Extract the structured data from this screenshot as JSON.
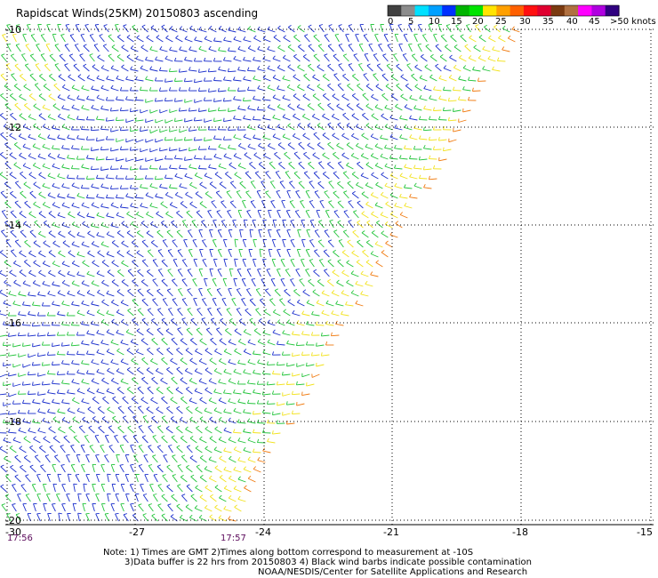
{
  "title": "Rapidscat Winds(25KM) 20150803 ascending",
  "legend": {
    "labels": [
      "0",
      "5",
      "10",
      "15",
      "20",
      "25",
      "30",
      "35",
      "40",
      "45",
      ">50 knots"
    ],
    "colors": [
      "#404040",
      "#8c8c8c",
      "#00e0ff",
      "#00a0ff",
      "#0030ff",
      "#00b400",
      "#00e400",
      "#ffe400",
      "#ffa000",
      "#ff6000",
      "#ff1010",
      "#e00030",
      "#7a3a10",
      "#b07040",
      "#ff00ff",
      "#b000e0",
      "#300080"
    ]
  },
  "map": {
    "latitudes": [
      "-10",
      "-12",
      "-14",
      "-16",
      "-18",
      "-20"
    ],
    "longitudes": [
      "-30",
      "-27",
      "-24",
      "-21",
      "-18",
      "-15"
    ],
    "times": [
      "17:56",
      "17:57"
    ],
    "grid": "dotted",
    "swath_colors": {
      "blue": "#1a2ecc",
      "green": "#22c43a",
      "yellow": "#f2e21c",
      "orange": "#f07a10"
    }
  },
  "notes": [
    "Note: 1) Times are GMT 2)Times along bottom correspond to measurement at -10S",
    "3)Data buffer is 22 hrs from 20150803 4) Black wind barbs indicate possible contamination",
    "NOAA/NESDIS/Center for Satellite Applications and Research"
  ]
}
